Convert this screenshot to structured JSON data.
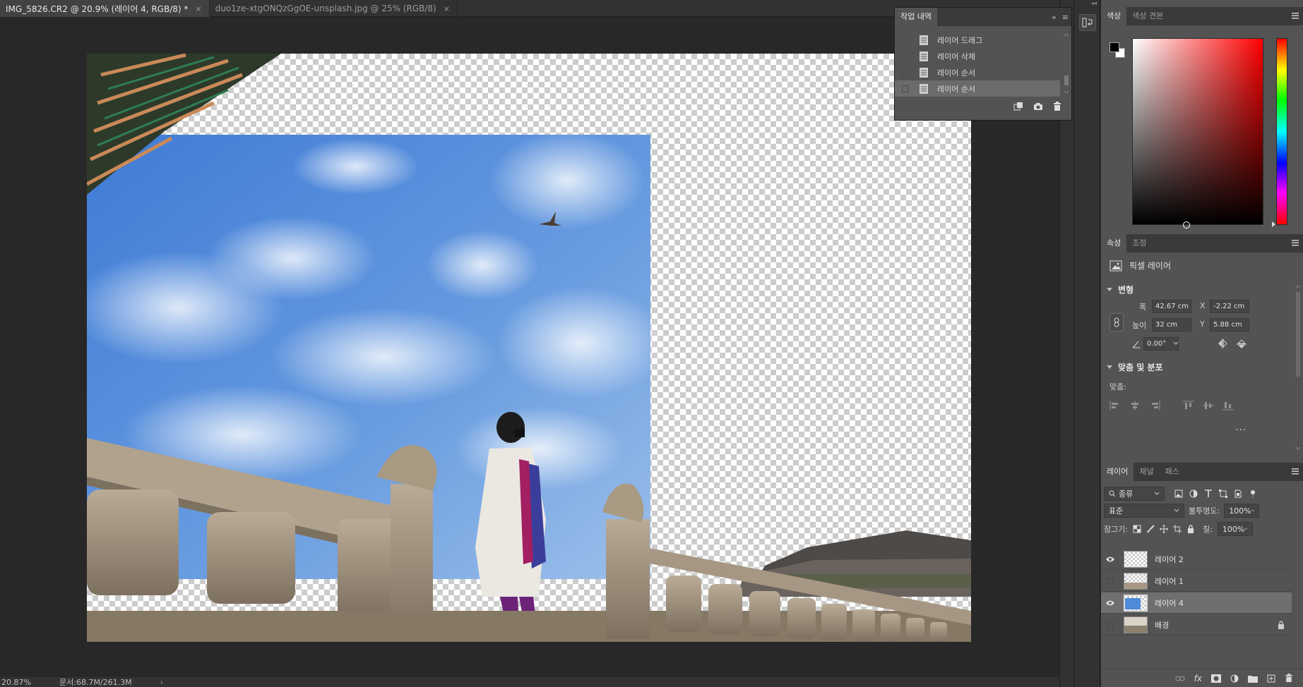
{
  "tabs": [
    {
      "label": "IMG_5826.CR2 @ 20.9% (레이어 4, RGB/8) *",
      "active": true
    },
    {
      "label": "duo1ze-xtgONQzGgOE-unsplash.jpg @ 25% (RGB/8)",
      "active": false
    }
  ],
  "tab_close": "×",
  "status": {
    "zoom": "20.87%",
    "doc": "문서:68.7M/261.3M",
    "arrow": "›"
  },
  "history": {
    "title": "작업 내역",
    "items": [
      {
        "label": "레이어 드래그",
        "selected": false
      },
      {
        "label": "레이어 삭제",
        "selected": false
      },
      {
        "label": "레이어 순서",
        "selected": false
      },
      {
        "label": "레이어 순서",
        "selected": true
      }
    ],
    "expand": "»",
    "menu": "≡"
  },
  "color_panel": {
    "tabs": [
      "색상",
      "색상 견본"
    ],
    "foreground": "#000000",
    "background": "#ffffff",
    "hue": "#ff0000"
  },
  "properties": {
    "tabs": [
      "속성",
      "조정"
    ],
    "layer_type": "픽셀 레이어",
    "transform_title": "변형",
    "width_label": "폭",
    "width": "42.67 cm",
    "height_label": "높이",
    "height": "32 cm",
    "x_label": "X",
    "x": "-2.22 cm",
    "y_label": "Y",
    "y": "5.88 cm",
    "angle": "0.00°",
    "align_title": "맞춤 및 분포",
    "align_label": "맞춤:",
    "more": "..."
  },
  "layers_panel": {
    "tabs": [
      "레이어",
      "채널",
      "패스"
    ],
    "filter": "종류",
    "blend_mode": "표준",
    "opacity_label": "불투명도:",
    "opacity": "100%",
    "lock_label": "잠그기:",
    "fill_label": "칠:",
    "fill": "100%",
    "layers": [
      {
        "name": "레이어 2",
        "visible": true,
        "selected": false,
        "locked": false
      },
      {
        "name": "레이어 1",
        "visible": false,
        "selected": false,
        "locked": false
      },
      {
        "name": "레이어 4",
        "visible": true,
        "selected": true,
        "locked": false
      },
      {
        "name": "배경",
        "visible": false,
        "selected": false,
        "locked": true
      }
    ],
    "fx": "fx"
  },
  "colors": {
    "ui_dark": "#323232",
    "panel": "#535353",
    "sky": "#4f8ad8",
    "stone": "#a69784"
  }
}
